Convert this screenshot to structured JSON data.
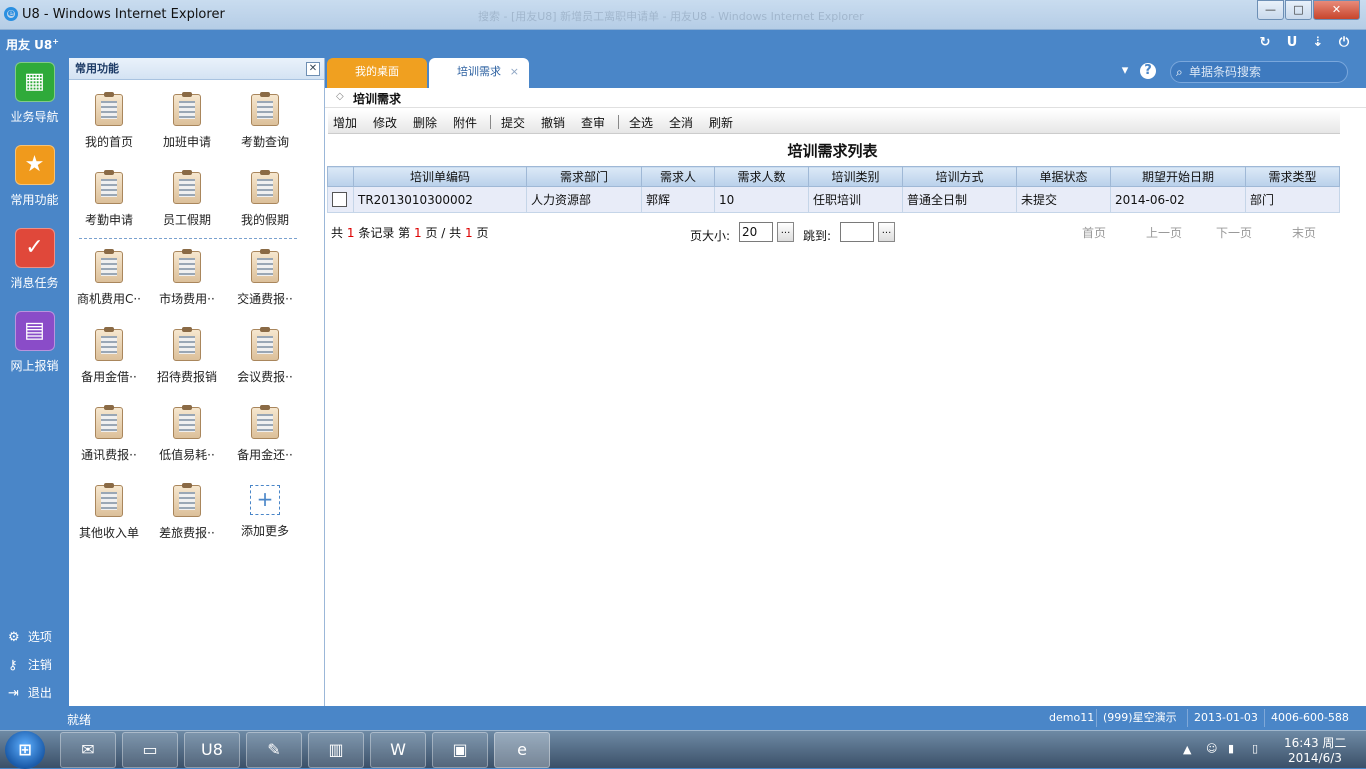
{
  "window": {
    "title": "U8 - Windows Internet Explorer",
    "blurred_title": "搜索 - [用友U8] 新增员工离职申请单 - 用友U8 - Windows Internet Explorer"
  },
  "app": {
    "logo": "用友 U8",
    "logo_sup": "+"
  },
  "leftnav": {
    "items": [
      {
        "label": "业务导航",
        "icon": "business-nav-icon",
        "color": "#2faa3a"
      },
      {
        "label": "常用功能",
        "icon": "star-icon",
        "color": "#f09a1c"
      },
      {
        "label": "消息任务",
        "icon": "task-check-icon",
        "color": "#e0483a"
      },
      {
        "label": "网上报销",
        "icon": "reimburse-icon",
        "color": "#8a4cc8"
      }
    ],
    "options": [
      {
        "label": "选项",
        "icon": "gear-icon"
      },
      {
        "label": "注销",
        "icon": "key-icon"
      },
      {
        "label": "退出",
        "icon": "exit-icon"
      }
    ]
  },
  "quickpanel": {
    "title": "常用功能",
    "items": [
      "我的首页",
      "加班申请",
      "考勤查询",
      "考勤申请",
      "员工假期",
      "我的假期",
      "商机费用C··",
      "市场费用··",
      "交通费报··",
      "备用金借··",
      "招待费报销",
      "会议费报··",
      "通讯费报··",
      "低值易耗··",
      "备用金还··",
      "其他收入单",
      "差旅费报··"
    ],
    "add_label": "添加更多"
  },
  "tabs": [
    {
      "label": "我的桌面"
    },
    {
      "label": "培训需求",
      "close": "×"
    }
  ],
  "search": {
    "placeholder": "单据条码搜索"
  },
  "page": {
    "title": "培训需求"
  },
  "toolbar": {
    "buttons": [
      "增加",
      "修改",
      "删除",
      "附件",
      "提交",
      "撤销",
      "查审",
      "全选",
      "全消",
      "刷新"
    ]
  },
  "list": {
    "title": "培训需求列表",
    "columns": [
      "培训单编码",
      "需求部门",
      "需求人",
      "需求人数",
      "培训类别",
      "培训方式",
      "单据状态",
      "期望开始日期",
      "需求类型"
    ],
    "rows": [
      [
        "TR2013010300002",
        "人力资源部",
        "郭辉",
        "10",
        "任职培训",
        "普通全日制",
        "未提交",
        "2014-06-02",
        "部门"
      ]
    ]
  },
  "pager": {
    "total_prefix": "共",
    "total": "1",
    "total_suffix": "条记录",
    "page_prefix": "第",
    "page": "1",
    "page_mid": "页 / 共",
    "pages": "1",
    "page_suffix": "页",
    "page_size_label": "页大小:",
    "page_size": "20",
    "jump_label": "跳到:",
    "more": "...",
    "links": [
      "首页",
      "上一页",
      "下一页",
      "末页"
    ]
  },
  "status": {
    "text": "就绪",
    "user": "demo11",
    "account": "(999)星空演示",
    "date": "2013-01-03",
    "phone": "4006-600-588"
  },
  "taskbar": {
    "time": "16:43 周二",
    "date": "2014/6/3"
  },
  "colors": {
    "brand": "#4a86c8",
    "tab_desk": "#f0a020",
    "highlight": "#d00"
  }
}
